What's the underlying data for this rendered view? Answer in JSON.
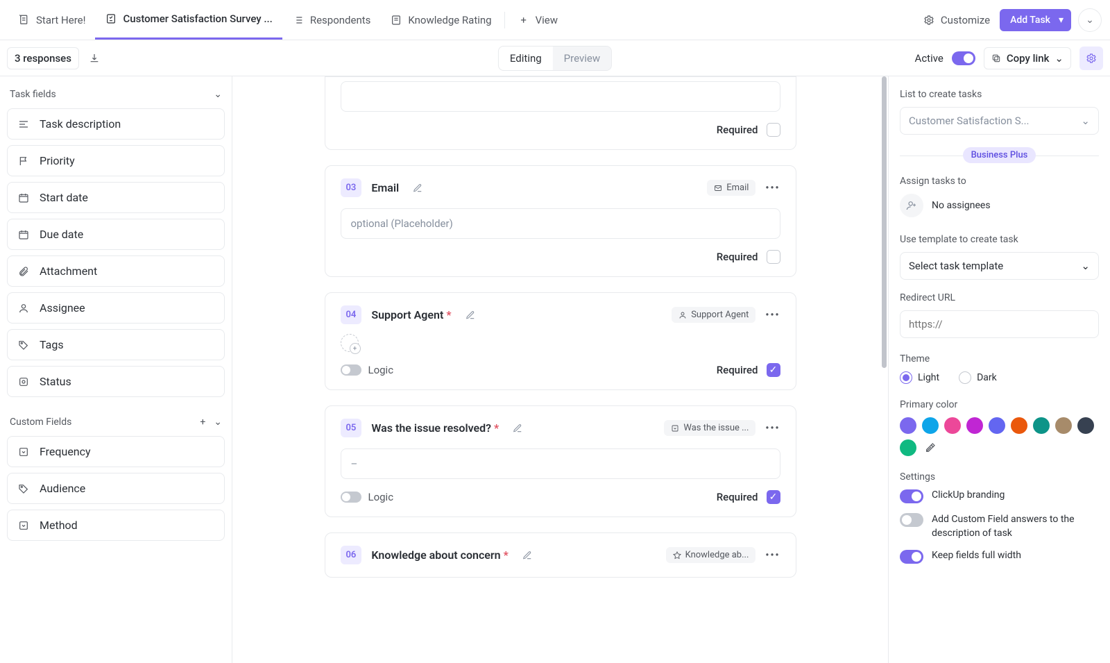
{
  "tabs": {
    "start": "Start Here!",
    "survey": "Customer Satisfaction Survey ...",
    "respondents": "Respondents",
    "knowledge": "Knowledge Rating",
    "view": "View"
  },
  "topRight": {
    "customize": "Customize",
    "addTask": "Add Task"
  },
  "subBar": {
    "responses": "3 responses",
    "editing": "Editing",
    "preview": "Preview",
    "active": "Active",
    "copyLink": "Copy link"
  },
  "sidebar": {
    "taskFieldsHeader": "Task fields",
    "customFieldsHeader": "Custom Fields",
    "taskFields": [
      {
        "label": "Task description",
        "icon": "align-left-icon"
      },
      {
        "label": "Priority",
        "icon": "flag-icon"
      },
      {
        "label": "Start date",
        "icon": "calendar-icon"
      },
      {
        "label": "Due date",
        "icon": "calendar-icon"
      },
      {
        "label": "Attachment",
        "icon": "paperclip-icon"
      },
      {
        "label": "Assignee",
        "icon": "user-icon"
      },
      {
        "label": "Tags",
        "icon": "tag-icon"
      },
      {
        "label": "Status",
        "icon": "status-icon"
      }
    ],
    "customFields": [
      {
        "label": "Frequency",
        "icon": "dropdown-icon"
      },
      {
        "label": "Audience",
        "icon": "tag-icon"
      },
      {
        "label": "Method",
        "icon": "dropdown-icon"
      }
    ]
  },
  "cards": {
    "prevRequired": "Required",
    "c3": {
      "num": "03",
      "title": "Email",
      "badge": "Email",
      "placeholder": "optional (Placeholder)",
      "required": "Required"
    },
    "c4": {
      "num": "04",
      "title": "Support Agent",
      "badge": "Support Agent",
      "logic": "Logic",
      "required": "Required"
    },
    "c5": {
      "num": "05",
      "title": "Was the issue resolved?",
      "badge": "Was the issue ...",
      "placeholder": "–",
      "logic": "Logic",
      "required": "Required"
    },
    "c6": {
      "num": "06",
      "title": "Knowledge about concern",
      "badge": "Knowledge ab..."
    }
  },
  "right": {
    "listLabel": "List to create tasks",
    "listValue": "Customer Satisfaction S...",
    "planBadge": "Business Plus",
    "assignLabel": "Assign tasks to",
    "noAssignees": "No assignees",
    "templateLabel": "Use template to create task",
    "templateValue": "Select task template",
    "redirectLabel": "Redirect URL",
    "redirectPlaceholder": "https://",
    "themeLabel": "Theme",
    "light": "Light",
    "dark": "Dark",
    "primaryColorLabel": "Primary color",
    "settingsLabel": "Settings",
    "s1": "ClickUp branding",
    "s2": "Add Custom Field answers to the description of task",
    "s3": "Keep fields full width",
    "colors": [
      "#7b68ee",
      "#0ea5e9",
      "#ec4899",
      "#c026d3",
      "#6366f1",
      "#ea580c",
      "#0d9488",
      "#a78b6a",
      "#374151",
      "#10b981"
    ]
  }
}
